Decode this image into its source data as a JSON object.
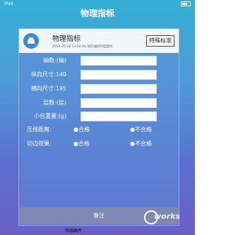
{
  "app": {
    "title": "物理指标"
  },
  "status_bar": {
    "left": "iPad"
  },
  "dialog": {
    "title": "物理指标",
    "subtitle": "2016-05-18 13:54:00   现在抽检的是面巾",
    "special_button_label": "特殊标准",
    "fields": [
      {
        "label": "抽数:(抽)",
        "value": ""
      },
      {
        "label": "纵向尺寸:140",
        "value": ""
      },
      {
        "label": "横向尺寸:195",
        "value": ""
      },
      {
        "label": "层数:(层)",
        "value": ""
      },
      {
        "label": "小包重量:(g)",
        "value": ""
      }
    ],
    "radio_rows": [
      {
        "label": "压线距离:",
        "options": [
          "●合格",
          "●不合格"
        ]
      },
      {
        "label": "切边效果:",
        "options": [
          "●合格",
          "●不合格"
        ]
      }
    ]
  },
  "footer": {
    "label": "备注"
  },
  "watermark": {
    "text": "works"
  },
  "caption": {
    "text": "作品图片"
  }
}
